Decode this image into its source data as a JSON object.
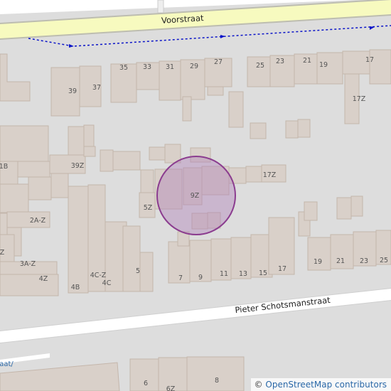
{
  "map": {
    "colors": {
      "background": "#dddddd",
      "building": "#d9d0c9",
      "building_outline": "#c4b6ab",
      "primary_road": "#f7fabf",
      "residential_road": "#ffffff",
      "footway": "#0b14c8",
      "marker_fill": "#b07cb8",
      "marker_stroke": "#8b3c8f"
    },
    "streets": {
      "north": "Voorstraat",
      "south": "Pieter Schotsmanstraat",
      "southwest_fragment": "aat/"
    },
    "marker": {
      "label": "9Z",
      "icon": "location-circle-icon"
    },
    "house_numbers": [
      "35",
      "33",
      "31",
      "29",
      "27",
      "25",
      "23",
      "21",
      "19",
      "17",
      "39",
      "37",
      "17Z",
      "39Z",
      "1B",
      "17Z",
      "5Z",
      "2A-Z",
      "Z",
      "3A-Z",
      "4Z",
      "4C-Z",
      "4C",
      "4B",
      "5",
      "7",
      "9",
      "11",
      "13",
      "15",
      "17",
      "19",
      "21",
      "23",
      "25",
      "6",
      "8",
      "6Z"
    ]
  },
  "attribution": {
    "symbol": "©",
    "text": "OpenStreetMap contributors"
  }
}
